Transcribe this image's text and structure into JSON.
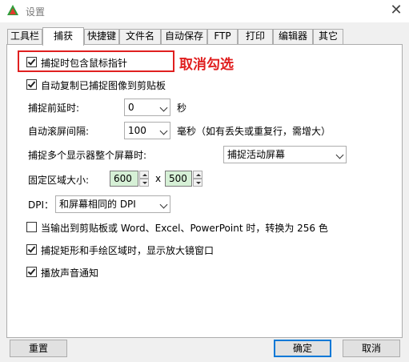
{
  "window": {
    "title": "设置",
    "close_glyph": "✕"
  },
  "tabs": [
    {
      "label": "工具栏"
    },
    {
      "label": "捕获",
      "active": true
    },
    {
      "label": "快捷键"
    },
    {
      "label": "文件名"
    },
    {
      "label": "自动保存"
    },
    {
      "label": "FTP"
    },
    {
      "label": "打印"
    },
    {
      "label": "编辑器"
    },
    {
      "label": "其它"
    }
  ],
  "options": {
    "include_cursor": {
      "label": "捕捉时包含鼠标指针",
      "checked": true
    },
    "auto_copy": {
      "label": "自动复制已捕捉图像到剪贴板",
      "checked": true
    },
    "delay": {
      "label": "捕捉前延时:",
      "value": "0",
      "unit": "秒"
    },
    "scroll_interval": {
      "label": "自动滚屏间隔:",
      "value": "100",
      "unit": "毫秒（如有丢失或重复行，需增大）"
    },
    "multi_monitor": {
      "label": "捕捉多个显示器整个屏幕时:",
      "value": "捕捉活动屏幕"
    },
    "fixed_region": {
      "label": "固定区域大小:",
      "width": "600",
      "separator": "x",
      "height": "500"
    },
    "dpi": {
      "label": "DPI：",
      "value": "和屏幕相同的 DPI"
    },
    "convert_256": {
      "label": "当输出到剪贴板或 Word、Excel、PowerPoint 时，转换为 256 色",
      "checked": false
    },
    "magnifier": {
      "label": "捕捉矩形和手绘区域时，显示放大镜窗口",
      "checked": true
    },
    "sound": {
      "label": "播放声音通知",
      "checked": true
    }
  },
  "annotation": {
    "text": "取消勾选",
    "color": "#e02020"
  },
  "buttons": {
    "reset": "重置",
    "ok": "确定",
    "cancel": "取消"
  },
  "colors": {
    "accent": "#0078d7",
    "number_field_bg": "#d6f0d6"
  }
}
